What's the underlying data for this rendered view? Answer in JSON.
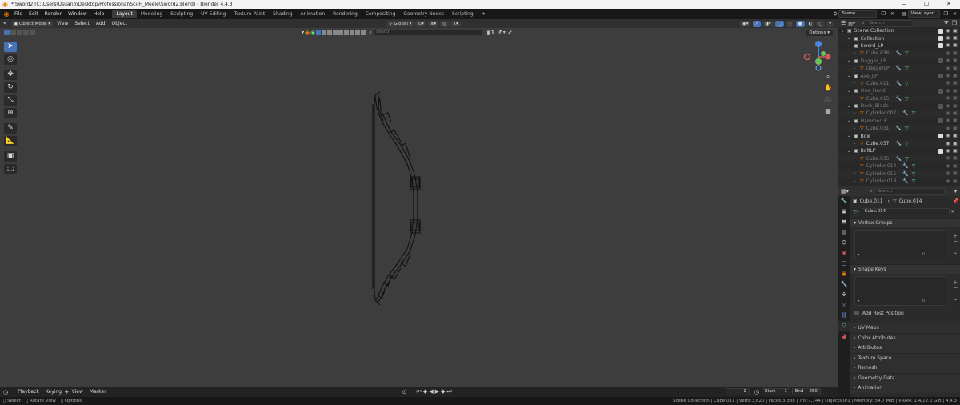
{
  "window": {
    "title": "* Sword2 [C:\\Users\\Usuario\\Desktop\\Professional\\Sci-Fi_Meele\\Sword2.blend] - Blender 4.4.3",
    "controls": [
      "—",
      "☐",
      "✕"
    ]
  },
  "menu": {
    "items": [
      "File",
      "Edit",
      "Render",
      "Window",
      "Help"
    ],
    "workspaces": [
      "Layout",
      "Modeling",
      "Sculpting",
      "UV Editing",
      "Texture Paint",
      "Shading",
      "Animation",
      "Rendering",
      "Compositing",
      "Geometry Nodes",
      "Scripting"
    ],
    "active_workspace": "Layout",
    "add_tab": "+",
    "scene": "Scene",
    "view_layer": "ViewLayer"
  },
  "viewport_header": {
    "mode": "Object Mode",
    "menus": [
      "View",
      "Select",
      "Add",
      "Object"
    ],
    "orientation": "Global",
    "search_placeholder": "Search",
    "options": "Options"
  },
  "timeline": {
    "menus": [
      "Playback",
      "Keying",
      "View",
      "Marker"
    ],
    "current_frame": "1",
    "start_label": "Start",
    "start_value": "1",
    "end_label": "End",
    "end_value": "250"
  },
  "statusbar": {
    "hints": [
      "Select",
      "Rotate View",
      "Options"
    ],
    "stats": "Scene Collection | Cube.011 | Verts:3,620 | Faces:3,388 | Tris:7,144 | Objects:0/1 | Memory: 54.7 MiB | VRAM: 1.4/12.0 GiB | 4.4.3"
  },
  "outliner": {
    "search_placeholder": "Search",
    "rows": [
      {
        "name": "Scene Collection",
        "indent": 0,
        "kind": "scene",
        "dim": false
      },
      {
        "name": "Collection",
        "indent": 1,
        "kind": "collection",
        "dim": false
      },
      {
        "name": "Sword_LP",
        "indent": 1,
        "kind": "collection",
        "dim": false
      },
      {
        "name": "Cube.036",
        "indent": 2,
        "kind": "mesh",
        "dim": true
      },
      {
        "name": "Dagger_LP",
        "indent": 1,
        "kind": "collection",
        "dim": true
      },
      {
        "name": "DaggerLP",
        "indent": 2,
        "kind": "mesh",
        "dim": true
      },
      {
        "name": "Axe_LP",
        "indent": 1,
        "kind": "collection",
        "dim": true
      },
      {
        "name": "Cube.011",
        "indent": 2,
        "kind": "mesh",
        "dim": true
      },
      {
        "name": "One_Hand",
        "indent": 1,
        "kind": "collection",
        "dim": true
      },
      {
        "name": "Cube.015",
        "indent": 2,
        "kind": "mesh",
        "dim": true
      },
      {
        "name": "Dock_Blade",
        "indent": 1,
        "kind": "collection",
        "dim": true
      },
      {
        "name": "Cylinder.007",
        "indent": 2,
        "kind": "mesh",
        "dim": true
      },
      {
        "name": "HammerLP",
        "indent": 1,
        "kind": "collection",
        "dim": true
      },
      {
        "name": "Cube.031",
        "indent": 2,
        "kind": "mesh",
        "dim": true
      },
      {
        "name": "Bow",
        "indent": 1,
        "kind": "collection",
        "dim": false
      },
      {
        "name": "Cube.037",
        "indent": 2,
        "kind": "mesh",
        "dim": false
      },
      {
        "name": "BoltLP",
        "indent": 1,
        "kind": "collection",
        "dim": false
      },
      {
        "name": "Cube.035",
        "indent": 2,
        "kind": "mesh",
        "dim": true
      },
      {
        "name": "Cylinder.014",
        "indent": 2,
        "kind": "mesh",
        "dim": true
      },
      {
        "name": "Cylinder.015",
        "indent": 2,
        "kind": "mesh",
        "dim": true
      },
      {
        "name": "Cylinder.018",
        "indent": 2,
        "kind": "mesh",
        "dim": true
      }
    ]
  },
  "properties": {
    "search_placeholder": "Search",
    "breadcrumb_object": "Cube.011",
    "breadcrumb_data": "Cube.014",
    "mesh_name": "Cube.014",
    "panels": {
      "vertex_groups": "Vertex Groups",
      "shape_keys": "Shape Keys",
      "add_rest_position": "Add Rest Position",
      "collapsed": [
        "UV Maps",
        "Color Attributes",
        "Attributes",
        "Texture Space",
        "Remesh",
        "Geometry Data",
        "Animation"
      ]
    }
  },
  "colors": {
    "accent": "#4772b3",
    "orange": "#e87d0d",
    "viewport_bg": "#3d3d3d",
    "mesh_green": "#6fd38f"
  }
}
